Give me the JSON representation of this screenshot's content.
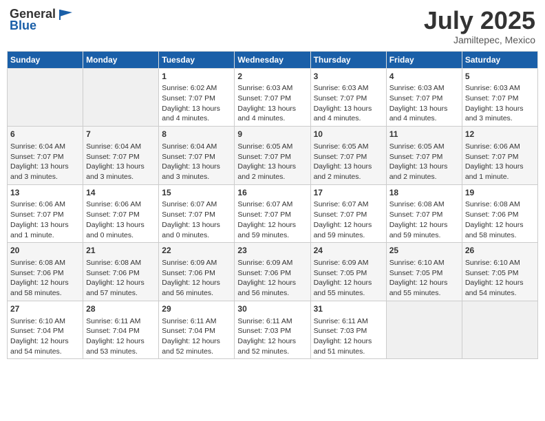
{
  "header": {
    "logo_general": "General",
    "logo_blue": "Blue",
    "month": "July 2025",
    "location": "Jamiltepec, Mexico"
  },
  "days_of_week": [
    "Sunday",
    "Monday",
    "Tuesday",
    "Wednesday",
    "Thursday",
    "Friday",
    "Saturday"
  ],
  "weeks": [
    [
      {
        "day": "",
        "sunrise": "",
        "sunset": "",
        "daylight": ""
      },
      {
        "day": "",
        "sunrise": "",
        "sunset": "",
        "daylight": ""
      },
      {
        "day": "1",
        "sunrise": "Sunrise: 6:02 AM",
        "sunset": "Sunset: 7:07 PM",
        "daylight": "Daylight: 13 hours and 4 minutes."
      },
      {
        "day": "2",
        "sunrise": "Sunrise: 6:03 AM",
        "sunset": "Sunset: 7:07 PM",
        "daylight": "Daylight: 13 hours and 4 minutes."
      },
      {
        "day": "3",
        "sunrise": "Sunrise: 6:03 AM",
        "sunset": "Sunset: 7:07 PM",
        "daylight": "Daylight: 13 hours and 4 minutes."
      },
      {
        "day": "4",
        "sunrise": "Sunrise: 6:03 AM",
        "sunset": "Sunset: 7:07 PM",
        "daylight": "Daylight: 13 hours and 4 minutes."
      },
      {
        "day": "5",
        "sunrise": "Sunrise: 6:03 AM",
        "sunset": "Sunset: 7:07 PM",
        "daylight": "Daylight: 13 hours and 3 minutes."
      }
    ],
    [
      {
        "day": "6",
        "sunrise": "Sunrise: 6:04 AM",
        "sunset": "Sunset: 7:07 PM",
        "daylight": "Daylight: 13 hours and 3 minutes."
      },
      {
        "day": "7",
        "sunrise": "Sunrise: 6:04 AM",
        "sunset": "Sunset: 7:07 PM",
        "daylight": "Daylight: 13 hours and 3 minutes."
      },
      {
        "day": "8",
        "sunrise": "Sunrise: 6:04 AM",
        "sunset": "Sunset: 7:07 PM",
        "daylight": "Daylight: 13 hours and 3 minutes."
      },
      {
        "day": "9",
        "sunrise": "Sunrise: 6:05 AM",
        "sunset": "Sunset: 7:07 PM",
        "daylight": "Daylight: 13 hours and 2 minutes."
      },
      {
        "day": "10",
        "sunrise": "Sunrise: 6:05 AM",
        "sunset": "Sunset: 7:07 PM",
        "daylight": "Daylight: 13 hours and 2 minutes."
      },
      {
        "day": "11",
        "sunrise": "Sunrise: 6:05 AM",
        "sunset": "Sunset: 7:07 PM",
        "daylight": "Daylight: 13 hours and 2 minutes."
      },
      {
        "day": "12",
        "sunrise": "Sunrise: 6:06 AM",
        "sunset": "Sunset: 7:07 PM",
        "daylight": "Daylight: 13 hours and 1 minute."
      }
    ],
    [
      {
        "day": "13",
        "sunrise": "Sunrise: 6:06 AM",
        "sunset": "Sunset: 7:07 PM",
        "daylight": "Daylight: 13 hours and 1 minute."
      },
      {
        "day": "14",
        "sunrise": "Sunrise: 6:06 AM",
        "sunset": "Sunset: 7:07 PM",
        "daylight": "Daylight: 13 hours and 0 minutes."
      },
      {
        "day": "15",
        "sunrise": "Sunrise: 6:07 AM",
        "sunset": "Sunset: 7:07 PM",
        "daylight": "Daylight: 13 hours and 0 minutes."
      },
      {
        "day": "16",
        "sunrise": "Sunrise: 6:07 AM",
        "sunset": "Sunset: 7:07 PM",
        "daylight": "Daylight: 12 hours and 59 minutes."
      },
      {
        "day": "17",
        "sunrise": "Sunrise: 6:07 AM",
        "sunset": "Sunset: 7:07 PM",
        "daylight": "Daylight: 12 hours and 59 minutes."
      },
      {
        "day": "18",
        "sunrise": "Sunrise: 6:08 AM",
        "sunset": "Sunset: 7:07 PM",
        "daylight": "Daylight: 12 hours and 59 minutes."
      },
      {
        "day": "19",
        "sunrise": "Sunrise: 6:08 AM",
        "sunset": "Sunset: 7:06 PM",
        "daylight": "Daylight: 12 hours and 58 minutes."
      }
    ],
    [
      {
        "day": "20",
        "sunrise": "Sunrise: 6:08 AM",
        "sunset": "Sunset: 7:06 PM",
        "daylight": "Daylight: 12 hours and 58 minutes."
      },
      {
        "day": "21",
        "sunrise": "Sunrise: 6:08 AM",
        "sunset": "Sunset: 7:06 PM",
        "daylight": "Daylight: 12 hours and 57 minutes."
      },
      {
        "day": "22",
        "sunrise": "Sunrise: 6:09 AM",
        "sunset": "Sunset: 7:06 PM",
        "daylight": "Daylight: 12 hours and 56 minutes."
      },
      {
        "day": "23",
        "sunrise": "Sunrise: 6:09 AM",
        "sunset": "Sunset: 7:06 PM",
        "daylight": "Daylight: 12 hours and 56 minutes."
      },
      {
        "day": "24",
        "sunrise": "Sunrise: 6:09 AM",
        "sunset": "Sunset: 7:05 PM",
        "daylight": "Daylight: 12 hours and 55 minutes."
      },
      {
        "day": "25",
        "sunrise": "Sunrise: 6:10 AM",
        "sunset": "Sunset: 7:05 PM",
        "daylight": "Daylight: 12 hours and 55 minutes."
      },
      {
        "day": "26",
        "sunrise": "Sunrise: 6:10 AM",
        "sunset": "Sunset: 7:05 PM",
        "daylight": "Daylight: 12 hours and 54 minutes."
      }
    ],
    [
      {
        "day": "27",
        "sunrise": "Sunrise: 6:10 AM",
        "sunset": "Sunset: 7:04 PM",
        "daylight": "Daylight: 12 hours and 54 minutes."
      },
      {
        "day": "28",
        "sunrise": "Sunrise: 6:11 AM",
        "sunset": "Sunset: 7:04 PM",
        "daylight": "Daylight: 12 hours and 53 minutes."
      },
      {
        "day": "29",
        "sunrise": "Sunrise: 6:11 AM",
        "sunset": "Sunset: 7:04 PM",
        "daylight": "Daylight: 12 hours and 52 minutes."
      },
      {
        "day": "30",
        "sunrise": "Sunrise: 6:11 AM",
        "sunset": "Sunset: 7:03 PM",
        "daylight": "Daylight: 12 hours and 52 minutes."
      },
      {
        "day": "31",
        "sunrise": "Sunrise: 6:11 AM",
        "sunset": "Sunset: 7:03 PM",
        "daylight": "Daylight: 12 hours and 51 minutes."
      },
      {
        "day": "",
        "sunrise": "",
        "sunset": "",
        "daylight": ""
      },
      {
        "day": "",
        "sunrise": "",
        "sunset": "",
        "daylight": ""
      }
    ]
  ]
}
